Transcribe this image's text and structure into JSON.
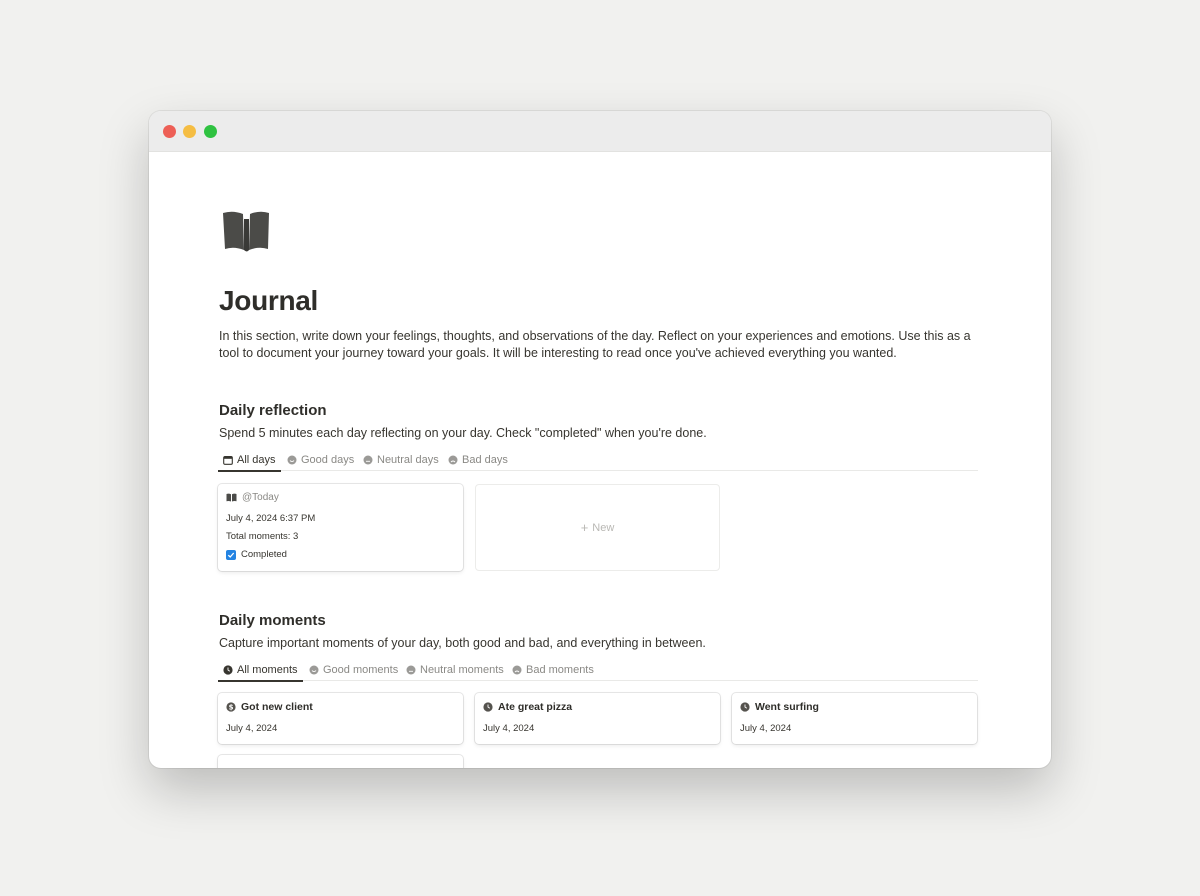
{
  "page": {
    "title": "Journal",
    "icon": "open-book-icon",
    "intro": "In this section, write down your feelings, thoughts, and observations of the day. Reflect on your experiences and emotions. Use this as a tool to document your journey toward your goals. It will be interesting to read once you've achieved everything you wanted."
  },
  "reflection": {
    "title": "Daily reflection",
    "description": "Spend 5 minutes each day reflecting on your day. Check \"completed\" when you're done.",
    "tabs": [
      {
        "label": "All days",
        "icon": "calendar-icon"
      },
      {
        "label": "Good days",
        "icon": "good-face-icon"
      },
      {
        "label": "Neutral days",
        "icon": "neutral-face-icon"
      },
      {
        "label": "Bad days",
        "icon": "bad-face-icon"
      }
    ],
    "card": {
      "title": "@Today",
      "datetime": "July 4, 2024 6:37 PM",
      "total_moments": "Total moments: 3",
      "completed_label": "Completed",
      "completed": true
    },
    "new_label": "New"
  },
  "moments": {
    "title": "Daily moments",
    "description": "Capture important moments of your day, both good and bad, and everything in between.",
    "tabs": [
      {
        "label": "All moments",
        "icon": "clock-icon"
      },
      {
        "label": "Good moments",
        "icon": "good-face-icon"
      },
      {
        "label": "Neutral moments",
        "icon": "neutral-face-icon"
      },
      {
        "label": "Bad moments",
        "icon": "bad-face-icon"
      }
    ],
    "cards": [
      {
        "title": "Got new client",
        "date": "July 4, 2024",
        "icon": "dollar-icon"
      },
      {
        "title": "Ate great pizza",
        "date": "July 4, 2024",
        "icon": "clock-icon"
      },
      {
        "title": "Went surfing",
        "date": "July 4, 2024",
        "icon": "clock-icon"
      }
    ]
  },
  "colors": {
    "accent_checkbox": "#2383e2",
    "text": "#37352f",
    "muted": "#8a8985"
  }
}
